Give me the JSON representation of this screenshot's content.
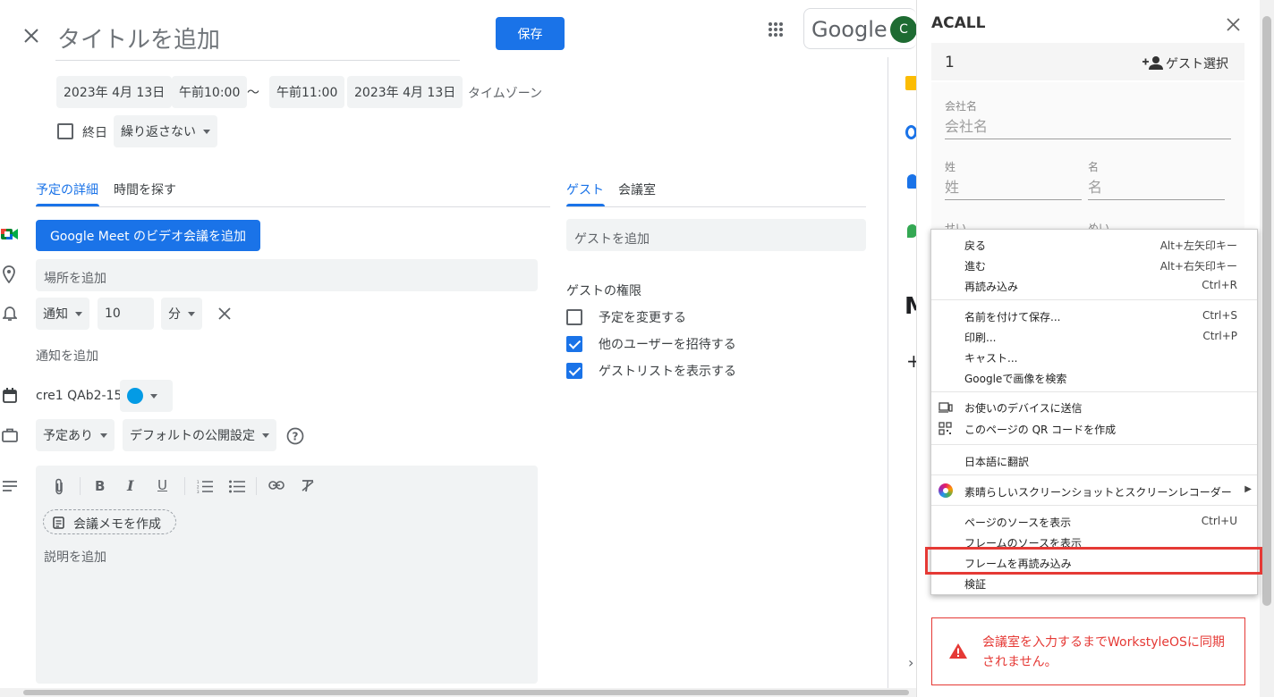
{
  "header": {
    "title_placeholder": "タイトルを追加",
    "save_label": "保存",
    "google_label": "Google",
    "avatar_letter": "C"
  },
  "datetime": {
    "start_date": "2023年 4月 13日",
    "start_time": "午前10:00",
    "separator": "〜",
    "end_time": "午前11:00",
    "end_date": "2023年 4月 13日",
    "timezone": "タイムゾーン",
    "allday_label": "終日",
    "repeat": "繰り返さない"
  },
  "tabs": {
    "details": "予定の詳細",
    "find_time": "時間を探す",
    "guests": "ゲスト",
    "rooms": "会議室"
  },
  "details": {
    "meet_button": "Google Meet のビデオ会議を追加",
    "location_placeholder": "場所を追加",
    "notify_type": "通知",
    "notify_value": "10",
    "notify_unit": "分",
    "add_notification": "通知を追加",
    "calendar_name": "cre1 QAb2-15",
    "calendar_color": "#039be5",
    "busy": "予定あり",
    "visibility": "デフォルトの公開設定",
    "meeting_notes": "会議メモを作成",
    "description_placeholder": "説明を追加"
  },
  "guests": {
    "add_placeholder": "ゲストを追加",
    "permissions_title": "ゲストの権限",
    "permissions": [
      {
        "label": "予定を変更する",
        "checked": false
      },
      {
        "label": "他のユーザーを招待する",
        "checked": true
      },
      {
        "label": "ゲストリストを表示する",
        "checked": true
      }
    ]
  },
  "panel": {
    "title": "ACALL",
    "guest_count": "1",
    "guest_select": "ゲスト選択",
    "company_label": "会社名",
    "company_placeholder": "会社名",
    "last_label": "姓",
    "last_placeholder": "姓",
    "first_label": "名",
    "first_placeholder": "名",
    "sei_label": "せい",
    "mei_label": "めい",
    "warning": "会議室を入力するまでWorkstyleOSに同期されません。",
    "warning_color": "#e53935"
  },
  "context_menu": {
    "items": [
      {
        "label": "戻る",
        "shortcut": "Alt+左矢印キー"
      },
      {
        "label": "進む",
        "shortcut": "Alt+右矢印キー"
      },
      {
        "label": "再読み込み",
        "shortcut": "Ctrl+R"
      },
      {
        "label": "名前を付けて保存...",
        "shortcut": "Ctrl+S"
      },
      {
        "label": "印刷...",
        "shortcut": "Ctrl+P"
      },
      {
        "label": "キャスト...",
        "shortcut": ""
      },
      {
        "label": "Googleで画像を検索",
        "shortcut": ""
      },
      {
        "label": "お使いのデバイスに送信",
        "shortcut": ""
      },
      {
        "label": "このページの QR コードを作成",
        "shortcut": ""
      },
      {
        "label": "日本語に翻訳",
        "shortcut": ""
      },
      {
        "label": "素晴らしいスクリーンショットとスクリーンレコーダー",
        "shortcut": ""
      },
      {
        "label": "ページのソースを表示",
        "shortcut": "Ctrl+U"
      },
      {
        "label": "フレームのソースを表示",
        "shortcut": ""
      },
      {
        "label": "フレームを再読み込み",
        "shortcut": ""
      },
      {
        "label": "検証",
        "shortcut": ""
      }
    ],
    "highlight_color": "#e53935"
  }
}
